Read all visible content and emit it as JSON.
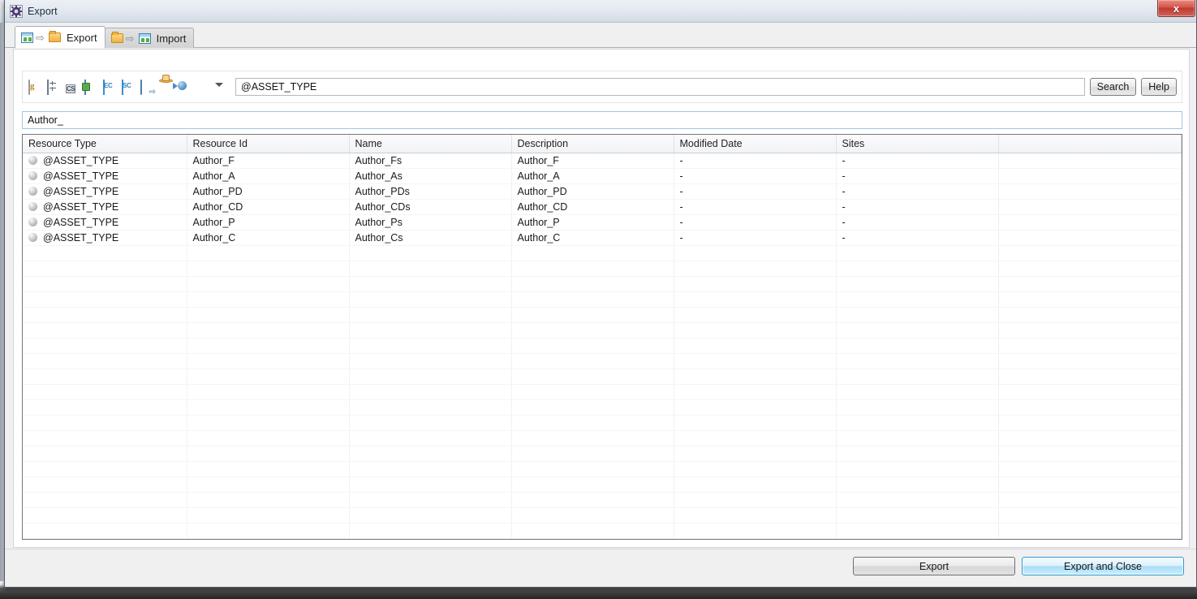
{
  "window": {
    "title": "Export",
    "title_icon": "gear-icon",
    "close_label": "x"
  },
  "tabs": [
    {
      "label": "Export",
      "active": true,
      "icon_left": "grid-icon",
      "icon_arrow": "arrow-right-icon",
      "icon_right": "folder-icon"
    },
    {
      "label": "Import",
      "active": false,
      "icon_left": "folder-icon",
      "icon_arrow": "arrow-right-icon",
      "icon_right": "grid-icon"
    }
  ],
  "toolbar": {
    "buttons": [
      {
        "name": "generate-document-icon"
      },
      {
        "name": "calculator-icon"
      },
      {
        "name": "cs-element-icon"
      },
      {
        "name": "screen-preview-icon"
      },
      {
        "name": "ec-element-icon"
      },
      {
        "name": "sc-element-icon"
      },
      {
        "name": "export-resource-icon"
      },
      {
        "name": "hat-icon"
      },
      {
        "name": "blue-sphere-play-icon"
      },
      {
        "name": "grey-sphere-icon"
      },
      {
        "name": "dropdown-caret-icon"
      }
    ]
  },
  "search": {
    "value": "@ASSET_TYPE",
    "placeholder": "",
    "search_button": "Search",
    "help_button": "Help"
  },
  "filter": {
    "value": "Author_",
    "placeholder": ""
  },
  "table": {
    "columns": [
      "Resource Type",
      "Resource Id",
      "Name",
      "Description",
      "Modified Date",
      "Sites",
      ""
    ],
    "rows": [
      {
        "type": "@ASSET_TYPE",
        "id": "Author_F",
        "name": "Author_Fs",
        "description": "Author_F",
        "modified": "-",
        "sites": "-",
        "extra": ""
      },
      {
        "type": "@ASSET_TYPE",
        "id": "Author_A",
        "name": "Author_As",
        "description": "Author_A",
        "modified": "-",
        "sites": "-",
        "extra": ""
      },
      {
        "type": "@ASSET_TYPE",
        "id": "Author_PD",
        "name": "Author_PDs",
        "description": "Author_PD",
        "modified": "-",
        "sites": "-",
        "extra": ""
      },
      {
        "type": "@ASSET_TYPE",
        "id": "Author_CD",
        "name": "Author_CDs",
        "description": "Author_CD",
        "modified": "-",
        "sites": "-",
        "extra": ""
      },
      {
        "type": "@ASSET_TYPE",
        "id": "Author_P",
        "name": "Author_Ps",
        "description": "Author_P",
        "modified": "-",
        "sites": "-",
        "extra": ""
      },
      {
        "type": "@ASSET_TYPE",
        "id": "Author_C",
        "name": "Author_Cs",
        "description": "Author_C",
        "modified": "-",
        "sites": "-",
        "extra": ""
      }
    ],
    "empty_row_count": 19
  },
  "footer": {
    "export_label": "Export",
    "export_and_close_label": "Export and Close"
  },
  "colors": {
    "accent_blue": "#2e9ad4",
    "close_red": "#bd3a30",
    "header_bg": "#f2f3f5",
    "window_bg": "#f0f0f0",
    "filter_border": "#9fc6e3"
  }
}
